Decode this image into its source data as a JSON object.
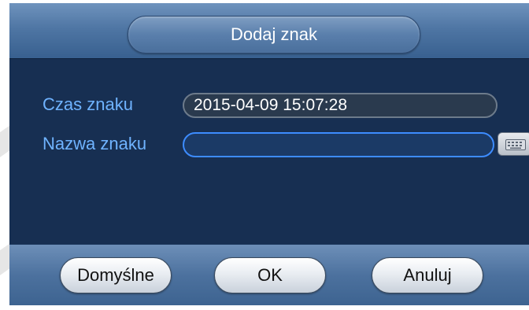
{
  "dialog": {
    "title": "Dodaj znak"
  },
  "form": {
    "mark_time_label": "Czas znaku",
    "mark_time_value": "2015-04-09 15:07:28",
    "mark_name_label": "Nazwa znaku",
    "mark_name_value": ""
  },
  "icons": {
    "keyboard": "keyboard-icon"
  },
  "buttons": {
    "default_label": "Domyślne",
    "ok_label": "OK",
    "cancel_label": "Anuluj"
  },
  "colors": {
    "panel_bg": "#172f52",
    "label_text": "#6fb3ff",
    "active_field_border": "#3d8cff"
  }
}
